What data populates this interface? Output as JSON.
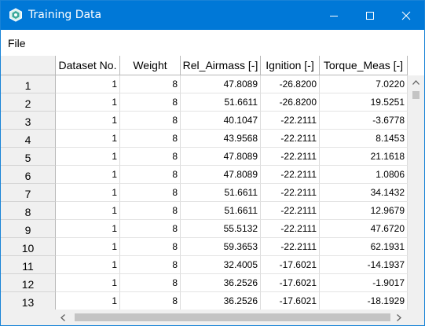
{
  "window": {
    "title": "Training Data",
    "accent_color": "#0078d7"
  },
  "menu": {
    "file_label": "File"
  },
  "table": {
    "columns": [
      "Dataset No.",
      "Weight",
      "Rel_Airmass [-]",
      "Ignition [-]",
      "Torque_Meas [-]"
    ],
    "rows": [
      {
        "num": "1",
        "cells": [
          "1",
          "8",
          "47.8089",
          "-26.8200",
          "7.0220"
        ]
      },
      {
        "num": "2",
        "cells": [
          "1",
          "8",
          "51.6611",
          "-26.8200",
          "19.5251"
        ]
      },
      {
        "num": "3",
        "cells": [
          "1",
          "8",
          "40.1047",
          "-22.2111",
          "-3.6778"
        ]
      },
      {
        "num": "4",
        "cells": [
          "1",
          "8",
          "43.9568",
          "-22.2111",
          "8.1453"
        ]
      },
      {
        "num": "5",
        "cells": [
          "1",
          "8",
          "47.8089",
          "-22.2111",
          "21.1618"
        ]
      },
      {
        "num": "6",
        "cells": [
          "1",
          "8",
          "47.8089",
          "-22.2111",
          "1.0806"
        ]
      },
      {
        "num": "7",
        "cells": [
          "1",
          "8",
          "51.6611",
          "-22.2111",
          "34.1432"
        ]
      },
      {
        "num": "8",
        "cells": [
          "1",
          "8",
          "51.6611",
          "-22.2111",
          "12.9679"
        ]
      },
      {
        "num": "9",
        "cells": [
          "1",
          "8",
          "55.5132",
          "-22.2111",
          "47.6720"
        ]
      },
      {
        "num": "10",
        "cells": [
          "1",
          "8",
          "59.3653",
          "-22.2111",
          "62.1931"
        ]
      },
      {
        "num": "11",
        "cells": [
          "1",
          "8",
          "32.4005",
          "-17.6021",
          "-14.1937"
        ]
      },
      {
        "num": "12",
        "cells": [
          "1",
          "8",
          "36.2526",
          "-17.6021",
          "-1.9017"
        ]
      },
      {
        "num": "13",
        "cells": [
          "1",
          "8",
          "36.2526",
          "-17.6021",
          "-18.1929"
        ]
      }
    ]
  }
}
